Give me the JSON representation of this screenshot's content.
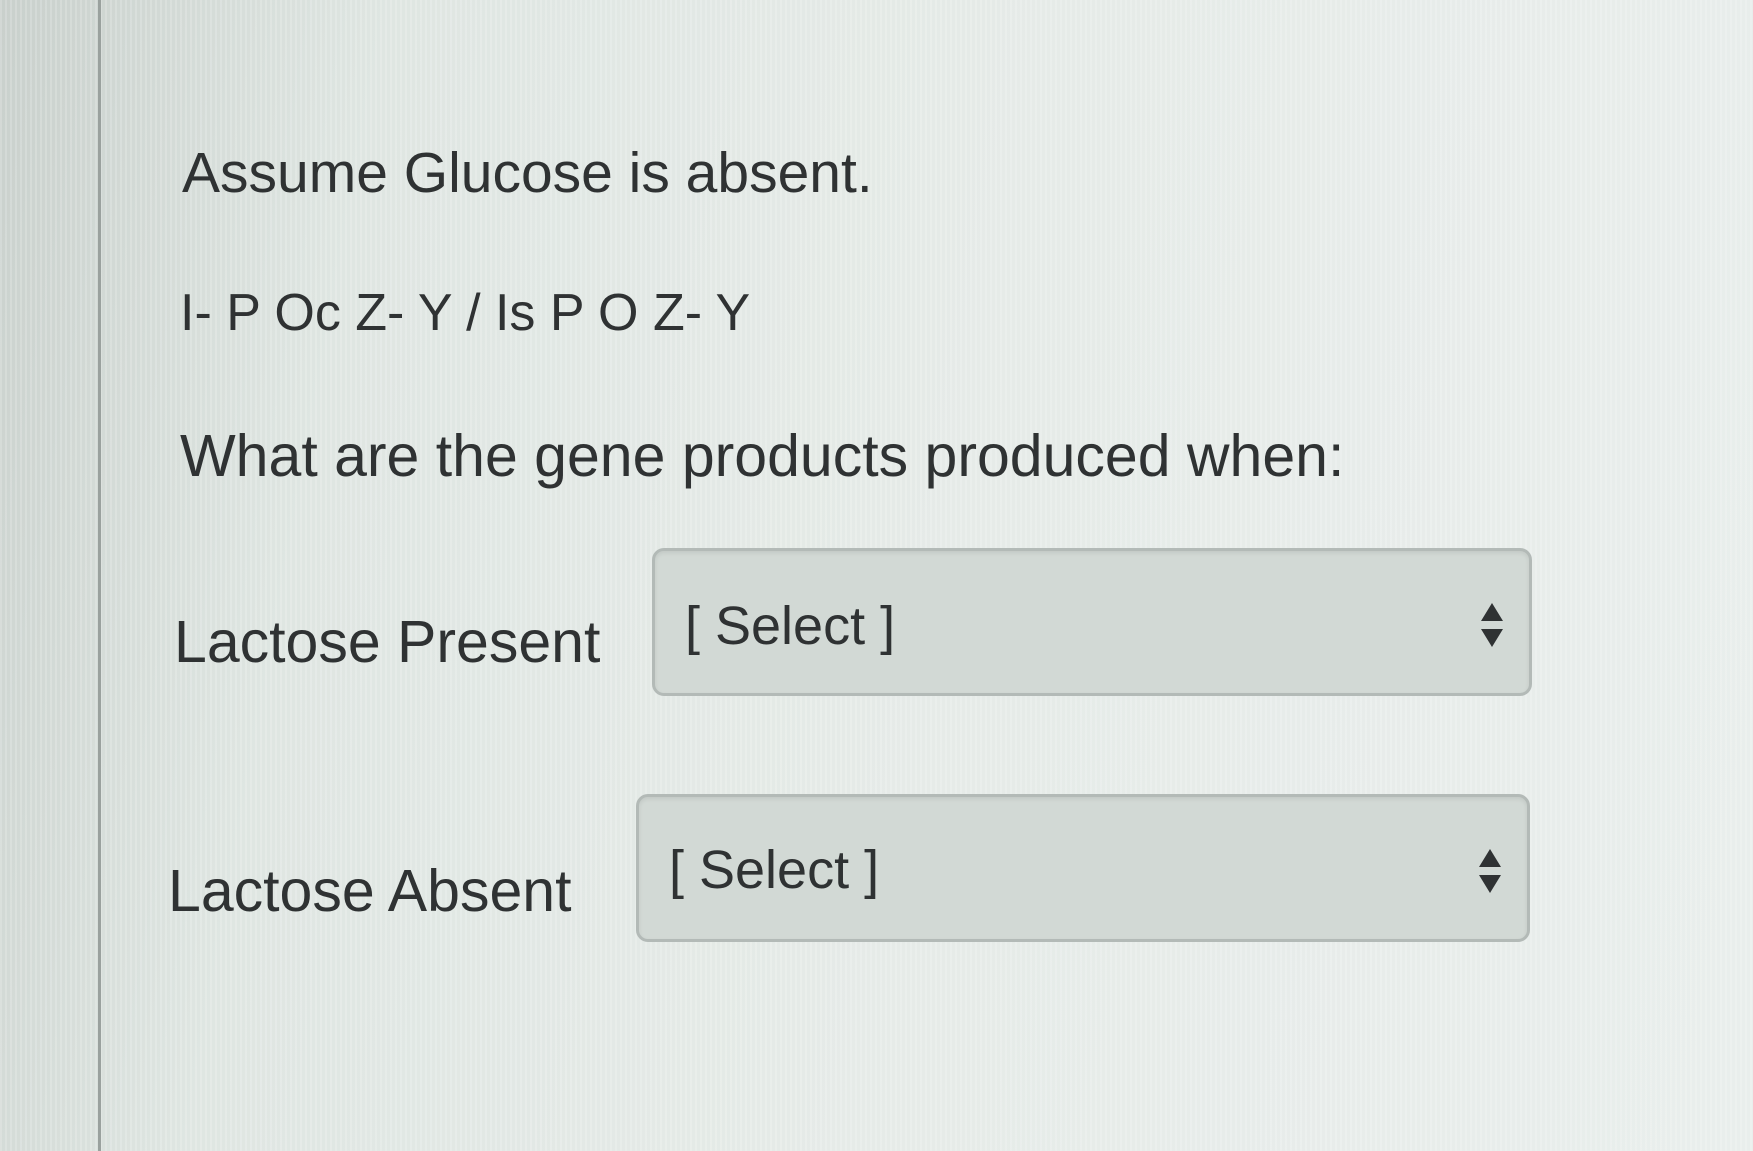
{
  "question": {
    "heading": "Assume Glucose is absent.",
    "genotype": "I- P Oc Z- Y / Is P O Z- Y",
    "prompt": "What are the gene products produced when:"
  },
  "rows": [
    {
      "label": "Lactose Present",
      "select_value": "[ Select ]",
      "icon": "up-down-arrows-icon"
    },
    {
      "label": "Lactose Absent",
      "select_value": "[ Select ]",
      "icon": "up-down-arrows-icon"
    }
  ],
  "colors": {
    "text": "#2f3233",
    "background": "#dde4e0",
    "select_fill": "#d2d9d5",
    "select_border": "#b3bab7"
  }
}
